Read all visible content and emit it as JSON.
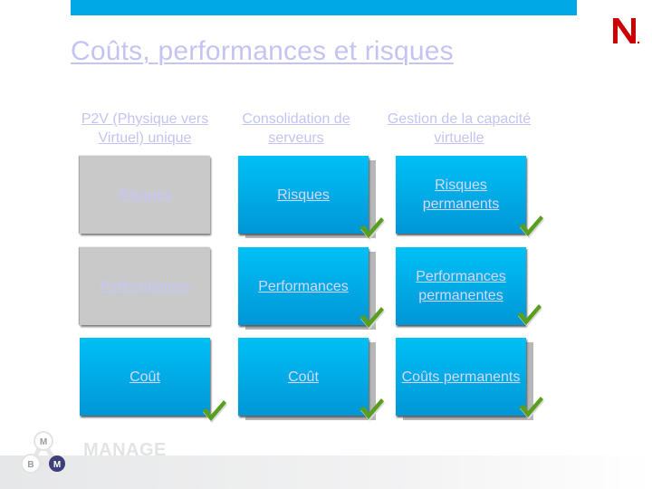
{
  "slide": {
    "title": "Coûts, performances et risques",
    "brand_logo": "N",
    "footer_logo_letters": [
      "M",
      "B",
      "M"
    ],
    "footer_label": "MANAGE",
    "colors": {
      "top_bar": "#00a9e6",
      "brand_red": "#cc0000",
      "card_blue": "#00b4ee",
      "card_grey": "#c9c9c9",
      "link_text": "#c4c4f2",
      "check_green": "#5a9e1e"
    }
  },
  "columns": [
    {
      "header": "P2V (Physique vers Virtuel) unique",
      "cards": [
        {
          "label": "Risques",
          "style": "grey",
          "checked": false
        },
        {
          "label": "Performances",
          "style": "grey",
          "checked": false
        },
        {
          "label": "Coût",
          "style": "blue",
          "checked": true
        }
      ]
    },
    {
      "header": "Consolidation de serveurs",
      "cards": [
        {
          "label": "Risques",
          "style": "blue",
          "checked": true
        },
        {
          "label": "Performances",
          "style": "blue",
          "checked": true
        },
        {
          "label": "Coût",
          "style": "blue",
          "checked": true
        }
      ]
    },
    {
      "header": "Gestion de la capacité virtuelle",
      "cards": [
        {
          "label": "Risques permanents",
          "style": "blue",
          "checked": true
        },
        {
          "label": "Performances permanentes",
          "style": "blue",
          "checked": true
        },
        {
          "label": "Coûts permanents",
          "style": "blue",
          "checked": true
        }
      ]
    }
  ]
}
